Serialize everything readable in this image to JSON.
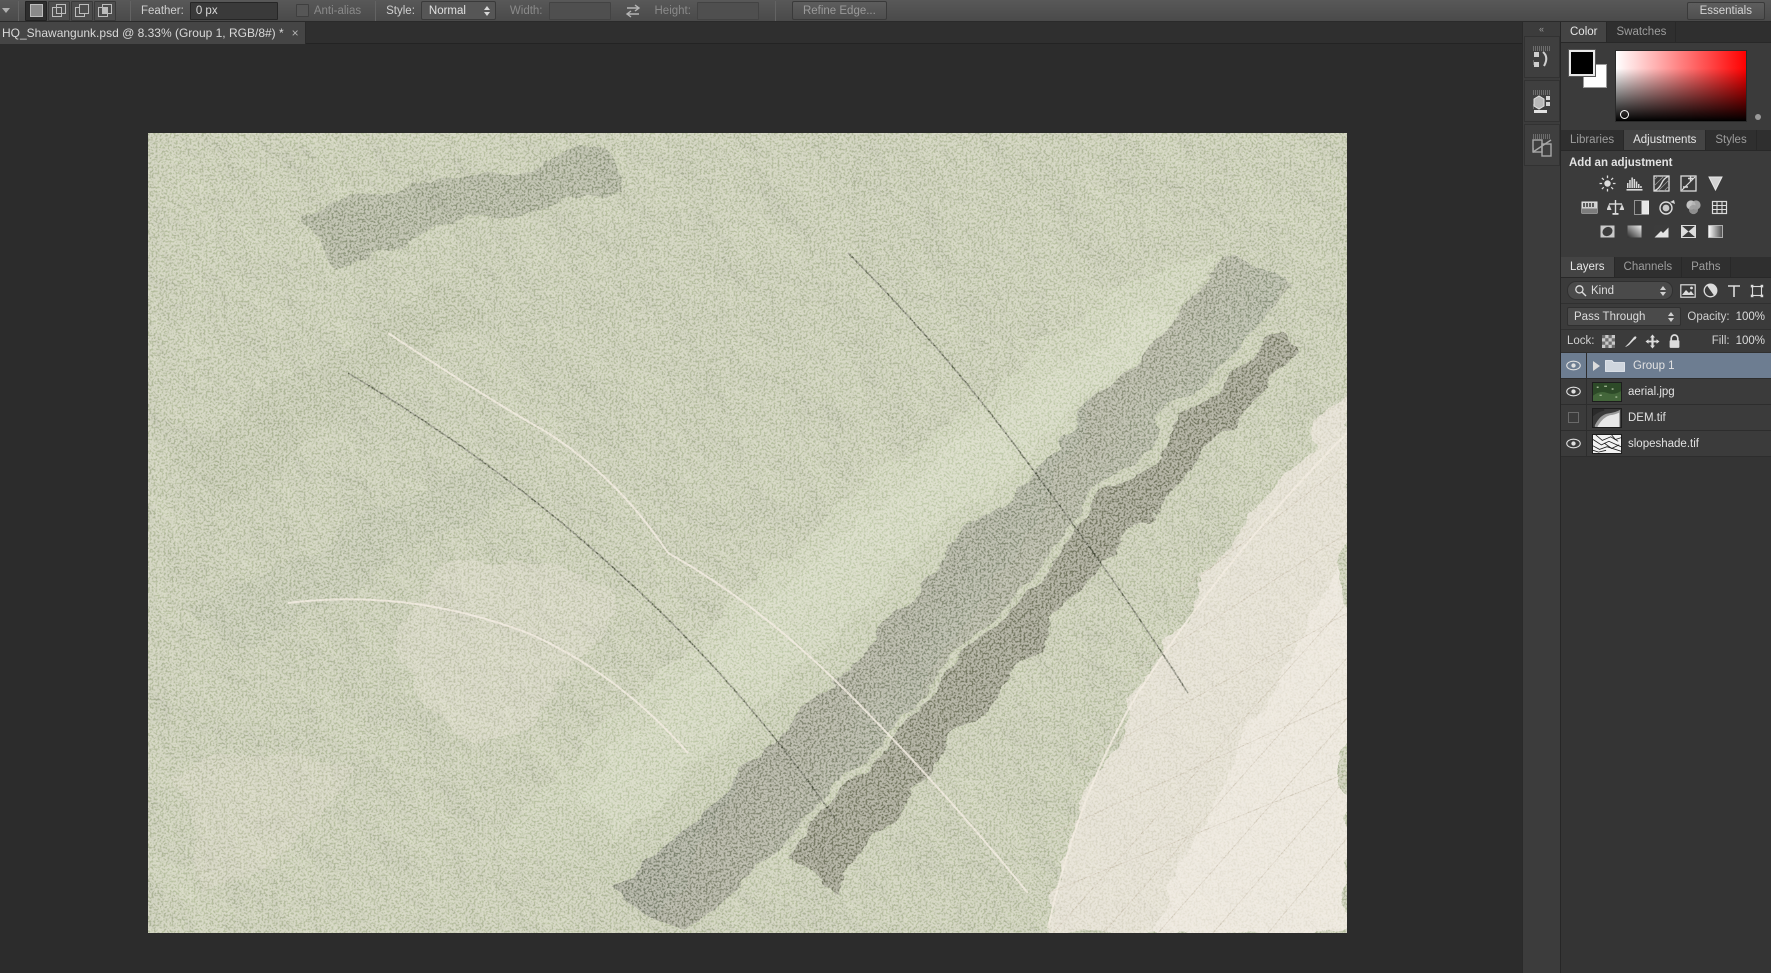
{
  "options_bar": {
    "selection_modes": [
      {
        "name": "new-selection",
        "label": "New selection",
        "active": true
      },
      {
        "name": "add-to-selection",
        "label": "Add to selection",
        "active": false
      },
      {
        "name": "subtract-from-selection",
        "label": "Subtract from selection",
        "active": false
      },
      {
        "name": "intersect-with-selection",
        "label": "Intersect with selection",
        "active": false
      }
    ],
    "feather_label": "Feather:",
    "feather_value": "0 px",
    "antialias_label": "Anti-alias",
    "antialias_checked": false,
    "style_label": "Style:",
    "style_value": "Normal",
    "width_label": "Width:",
    "width_value": "",
    "height_label": "Height:",
    "height_value": "",
    "swap_icon": "swap-arrows-icon",
    "refine_edge_label": "Refine Edge...",
    "workspace_label": "Essentials"
  },
  "document_tab": {
    "title": "HQ_Shawangunk.psd @ 8.33% (Group 1, RGB/8#) *",
    "close_label": "×"
  },
  "canvas": {
    "zoom": "8.33%",
    "image_description": "Shaded-relief aerial composite of the Shawangunk Ridge"
  },
  "rail": {
    "collapse_label": "«",
    "buttons": [
      {
        "name": "history-panel-icon",
        "label": "History"
      },
      {
        "name": "3d-panel-icon",
        "label": "3D"
      },
      {
        "name": "layer-comps-panel-icon",
        "label": "Layer Comps"
      }
    ]
  },
  "color_panel": {
    "tabs": [
      {
        "label": "Color",
        "active": true
      },
      {
        "label": "Swatches",
        "active": false
      }
    ],
    "foreground_color": "#000000",
    "background_color": "#ffffff",
    "ramp_end_color": "#ff0000"
  },
  "adjustments_panel": {
    "tabs": [
      {
        "label": "Libraries",
        "active": false
      },
      {
        "label": "Adjustments",
        "active": true
      },
      {
        "label": "Styles",
        "active": false
      }
    ],
    "heading": "Add an adjustment",
    "rows": [
      [
        {
          "name": "brightness-contrast-icon",
          "label": "Brightness/Contrast"
        },
        {
          "name": "levels-icon",
          "label": "Levels"
        },
        {
          "name": "curves-icon",
          "label": "Curves"
        },
        {
          "name": "exposure-icon",
          "label": "Exposure"
        },
        {
          "name": "vibrance-icon",
          "label": "Vibrance"
        }
      ],
      [
        {
          "name": "hue-saturation-icon",
          "label": "Hue/Saturation"
        },
        {
          "name": "color-balance-icon",
          "label": "Color Balance"
        },
        {
          "name": "black-white-icon",
          "label": "Black & White"
        },
        {
          "name": "photo-filter-icon",
          "label": "Photo Filter"
        },
        {
          "name": "channel-mixer-icon",
          "label": "Channel Mixer"
        },
        {
          "name": "color-lookup-icon",
          "label": "Color Lookup"
        }
      ],
      [
        {
          "name": "invert-icon",
          "label": "Invert"
        },
        {
          "name": "posterize-icon",
          "label": "Posterize"
        },
        {
          "name": "threshold-icon",
          "label": "Threshold"
        },
        {
          "name": "selective-color-icon",
          "label": "Selective Color"
        },
        {
          "name": "gradient-map-icon",
          "label": "Gradient Map"
        }
      ]
    ]
  },
  "layers_panel": {
    "tabs": [
      {
        "label": "Layers",
        "active": true
      },
      {
        "label": "Channels",
        "active": false
      },
      {
        "label": "Paths",
        "active": false
      }
    ],
    "filter_label": "Kind",
    "filter_icons": [
      {
        "name": "filter-pixel-layers-icon",
        "label": "Pixel layers"
      },
      {
        "name": "filter-adjustment-layers-icon",
        "label": "Adjustment layers"
      },
      {
        "name": "filter-type-layers-icon",
        "label": "Type layers"
      },
      {
        "name": "filter-shape-layers-icon",
        "label": "Shape layers"
      }
    ],
    "blend_mode": "Pass Through",
    "opacity_label": "Opacity:",
    "opacity_value": "100%",
    "lock_label": "Lock:",
    "lock_icons": [
      {
        "name": "lock-transparent-pixels-icon",
        "label": "Lock transparent pixels"
      },
      {
        "name": "lock-image-pixels-icon",
        "label": "Lock image pixels"
      },
      {
        "name": "lock-position-icon",
        "label": "Lock position"
      },
      {
        "name": "lock-all-icon",
        "label": "Lock all"
      }
    ],
    "fill_label": "Fill:",
    "fill_value": "100%",
    "layers": [
      {
        "name": "Group 1",
        "type": "group",
        "visible": true,
        "selected": true,
        "expanded": false
      },
      {
        "name": "aerial.jpg",
        "type": "image",
        "visible": true,
        "selected": false
      },
      {
        "name": "DEM.tif",
        "type": "image",
        "visible": false,
        "selected": false
      },
      {
        "name": "slopeshade.tif",
        "type": "image",
        "visible": true,
        "selected": false
      }
    ],
    "selection_color": "#6d7d91"
  }
}
